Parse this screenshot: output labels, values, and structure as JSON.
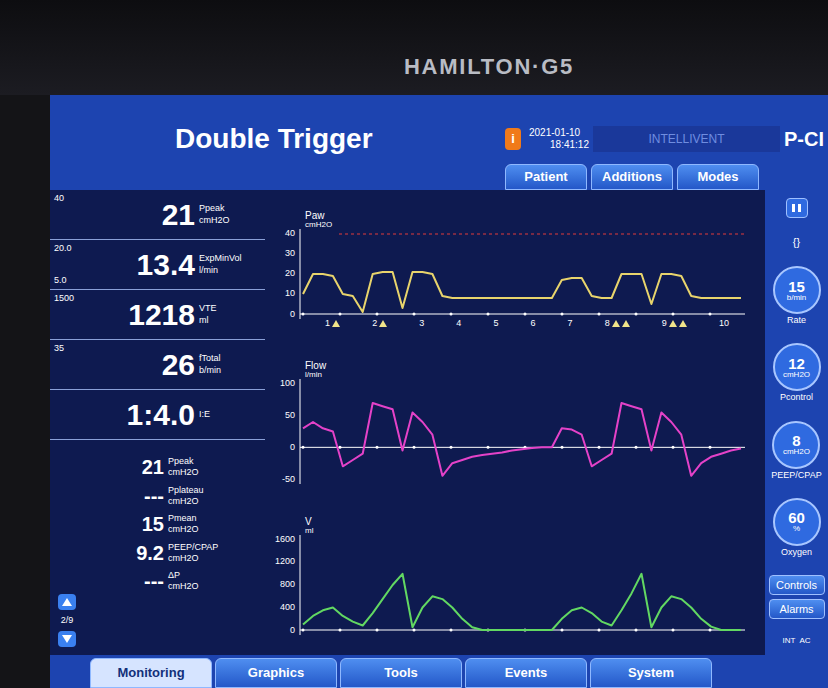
{
  "brand": "HAMILTON·G5",
  "annotation": "Double Trigger",
  "header": {
    "alert_icon": "i",
    "date": "2021-01-10",
    "time": "18:41:12",
    "mode_name": "INTELLIVENT",
    "mode": "P-CI"
  },
  "top_tabs": [
    {
      "label": "Patient",
      "selected": false
    },
    {
      "label": "Additions",
      "selected": false
    },
    {
      "label": "Modes",
      "selected": false
    }
  ],
  "main_params": [
    {
      "name": "Ppeak",
      "unit": "cmH2O",
      "value": "21",
      "high": "40",
      "low": ""
    },
    {
      "name": "ExpMinVol",
      "unit": "l/min",
      "value": "13.4",
      "high": "20.0",
      "low": "5.0"
    },
    {
      "name": "VTE",
      "unit": "ml",
      "value": "1218",
      "high": "1500",
      "low": ""
    },
    {
      "name": "fTotal",
      "unit": "b/min",
      "value": "26",
      "high": "35",
      "low": ""
    },
    {
      "name": "I:E",
      "unit": "",
      "value": "1:4.0",
      "high": "",
      "low": ""
    }
  ],
  "secondary_params": [
    {
      "name": "Ppeak",
      "unit": "cmH2O",
      "value": "21"
    },
    {
      "name": "Pplateau",
      "unit": "cmH2O",
      "value": "---"
    },
    {
      "name": "Pmean",
      "unit": "cmH2O",
      "value": "15"
    },
    {
      "name": "PEEP/CPAP",
      "unit": "cmH2O",
      "value": "9.2"
    },
    {
      "name": "ΔP",
      "unit": "cmH2O",
      "value": "---"
    }
  ],
  "page": "2/9",
  "charts": [
    {
      "title": "Paw",
      "unit": "cmH2O",
      "ticks": [
        "40",
        "30",
        "20",
        "10",
        "0"
      ],
      "color": "#e8d46c",
      "limit": 40,
      "values": [
        10,
        20,
        20,
        19,
        10,
        9,
        1,
        20,
        21,
        21,
        3,
        21,
        21,
        20,
        9,
        8,
        8,
        8,
        8,
        8,
        8,
        8,
        8,
        8,
        8,
        8,
        17,
        18,
        18,
        9,
        8,
        8,
        20,
        20,
        20,
        5,
        20,
        20,
        19,
        9,
        8,
        8,
        8,
        8,
        8
      ]
    },
    {
      "title": "Flow",
      "unit": "l/min",
      "ticks": [
        "100",
        "50",
        "0",
        "-50"
      ],
      "color": "#e442c8",
      "values": [
        30,
        40,
        30,
        25,
        -30,
        -20,
        -10,
        70,
        65,
        60,
        -5,
        55,
        40,
        20,
        -45,
        -25,
        -20,
        -15,
        -12,
        -10,
        -8,
        -5,
        -3,
        -1,
        0,
        0,
        30,
        28,
        20,
        -30,
        -20,
        -10,
        70,
        65,
        60,
        -5,
        55,
        40,
        20,
        -45,
        -25,
        -15,
        -10,
        -5,
        -2
      ]
    },
    {
      "title": "V",
      "unit": "ml",
      "ticks": [
        "1600",
        "1200",
        "800",
        "400",
        "0"
      ],
      "color": "#62d862",
      "values": [
        100,
        250,
        350,
        400,
        250,
        150,
        80,
        300,
        550,
        800,
        1000,
        50,
        400,
        600,
        550,
        400,
        200,
        50,
        0,
        0,
        0,
        0,
        0,
        0,
        0,
        0,
        200,
        350,
        400,
        300,
        150,
        80,
        350,
        650,
        1000,
        50,
        400,
        600,
        550,
        400,
        200,
        60,
        0,
        0,
        0
      ]
    }
  ],
  "breaths": [
    {
      "label": "1",
      "marker": "single"
    },
    {
      "label": "2",
      "marker": "single"
    },
    {
      "label": "3",
      "marker": "none"
    },
    {
      "label": "4",
      "marker": "none"
    },
    {
      "label": "5",
      "marker": "none"
    },
    {
      "label": "6",
      "marker": "none"
    },
    {
      "label": "7",
      "marker": "none"
    },
    {
      "label": "8",
      "marker": "double"
    },
    {
      "label": "9",
      "marker": "double"
    },
    {
      "label": "10",
      "marker": "none"
    }
  ],
  "mode_glyph": "{}",
  "controls": [
    {
      "name": "Rate",
      "value": "15",
      "unit": "b/min"
    },
    {
      "name": "Pcontrol",
      "value": "12",
      "unit": "cmH2O"
    },
    {
      "name": "PEEP/CPAP",
      "value": "8",
      "unit": "cmH2O"
    },
    {
      "name": "Oxygen",
      "value": "60",
      "unit": "%"
    }
  ],
  "side_buttons": [
    "Controls",
    "Alarms"
  ],
  "power": [
    "INT",
    "AC"
  ],
  "bottom_tabs": [
    {
      "label": "Monitoring",
      "selected": true
    },
    {
      "label": "Graphics",
      "selected": false
    },
    {
      "label": "Tools",
      "selected": false
    },
    {
      "label": "Events",
      "selected": false
    },
    {
      "label": "System",
      "selected": false
    }
  ]
}
